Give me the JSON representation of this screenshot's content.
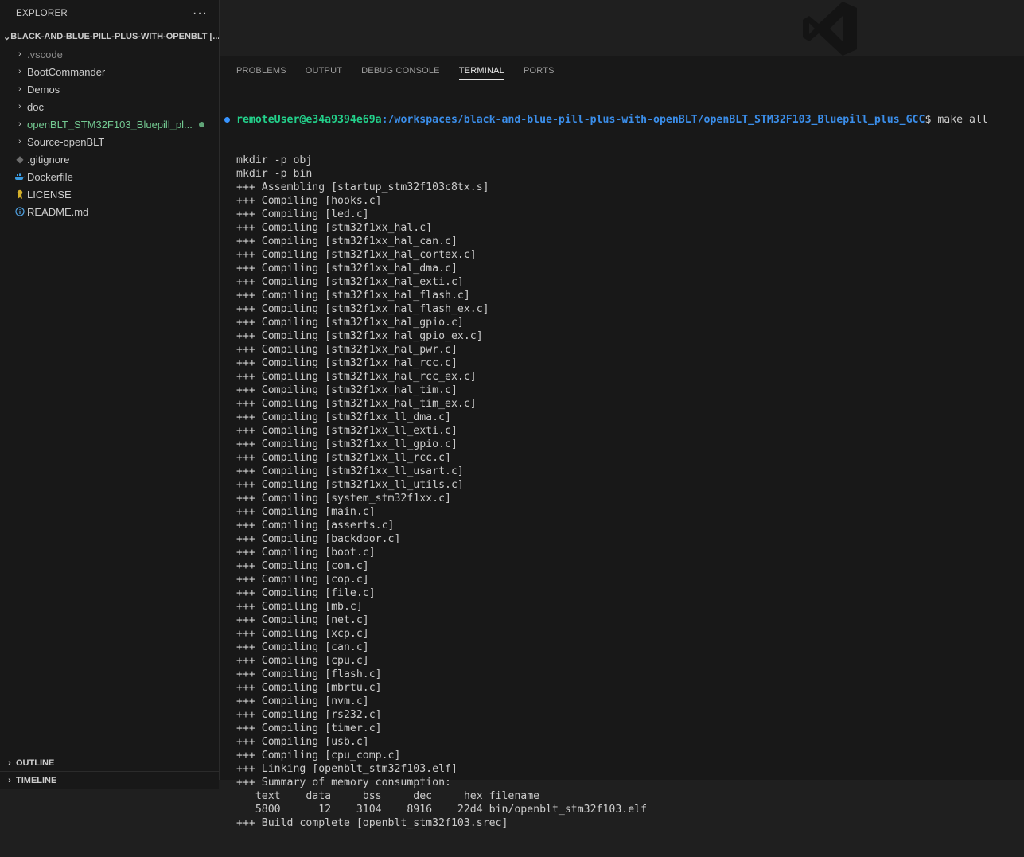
{
  "sidebar": {
    "title": "EXPLORER",
    "more": "···",
    "workspace": "BLACK-AND-BLUE-PILL-PLUS-WITH-OPENBLT [...",
    "items": [
      {
        "label": ".vscode",
        "kind": "folder"
      },
      {
        "label": "BootCommander",
        "kind": "folder"
      },
      {
        "label": "Demos",
        "kind": "folder"
      },
      {
        "label": "doc",
        "kind": "folder"
      },
      {
        "label": "openBLT_STM32F103_Bluepill_pl...",
        "kind": "folder"
      },
      {
        "label": "Source-openBLT",
        "kind": "folder"
      },
      {
        "label": ".gitignore",
        "kind": "file"
      },
      {
        "label": "Dockerfile",
        "kind": "file"
      },
      {
        "label": "LICENSE",
        "kind": "file"
      },
      {
        "label": "README.md",
        "kind": "file"
      }
    ],
    "outline": "OUTLINE",
    "timeline": "TIMELINE"
  },
  "panel": {
    "tabs": [
      "PROBLEMS",
      "OUTPUT",
      "DEBUG CONSOLE",
      "TERMINAL",
      "PORTS"
    ],
    "active_tab": "TERMINAL"
  },
  "terminal": {
    "prompt_user": "remoteUser@e34a9394e69a",
    "prompt_path": ":/workspaces/black-and-blue-pill-plus-with-openBLT/openBLT_STM32F103_Bluepill_plus_GCC",
    "prompt_cmd": "$ make all",
    "lines": [
      "mkdir -p obj",
      "mkdir -p bin",
      "+++ Assembling [startup_stm32f103c8tx.s]",
      "+++ Compiling [hooks.c]",
      "+++ Compiling [led.c]",
      "+++ Compiling [stm32f1xx_hal.c]",
      "+++ Compiling [stm32f1xx_hal_can.c]",
      "+++ Compiling [stm32f1xx_hal_cortex.c]",
      "+++ Compiling [stm32f1xx_hal_dma.c]",
      "+++ Compiling [stm32f1xx_hal_exti.c]",
      "+++ Compiling [stm32f1xx_hal_flash.c]",
      "+++ Compiling [stm32f1xx_hal_flash_ex.c]",
      "+++ Compiling [stm32f1xx_hal_gpio.c]",
      "+++ Compiling [stm32f1xx_hal_gpio_ex.c]",
      "+++ Compiling [stm32f1xx_hal_pwr.c]",
      "+++ Compiling [stm32f1xx_hal_rcc.c]",
      "+++ Compiling [stm32f1xx_hal_rcc_ex.c]",
      "+++ Compiling [stm32f1xx_hal_tim.c]",
      "+++ Compiling [stm32f1xx_hal_tim_ex.c]",
      "+++ Compiling [stm32f1xx_ll_dma.c]",
      "+++ Compiling [stm32f1xx_ll_exti.c]",
      "+++ Compiling [stm32f1xx_ll_gpio.c]",
      "+++ Compiling [stm32f1xx_ll_rcc.c]",
      "+++ Compiling [stm32f1xx_ll_usart.c]",
      "+++ Compiling [stm32f1xx_ll_utils.c]",
      "+++ Compiling [system_stm32f1xx.c]",
      "+++ Compiling [main.c]",
      "+++ Compiling [asserts.c]",
      "+++ Compiling [backdoor.c]",
      "+++ Compiling [boot.c]",
      "+++ Compiling [com.c]",
      "+++ Compiling [cop.c]",
      "+++ Compiling [file.c]",
      "+++ Compiling [mb.c]",
      "+++ Compiling [net.c]",
      "+++ Compiling [xcp.c]",
      "+++ Compiling [can.c]",
      "+++ Compiling [cpu.c]",
      "+++ Compiling [flash.c]",
      "+++ Compiling [mbrtu.c]",
      "+++ Compiling [nvm.c]",
      "+++ Compiling [rs232.c]",
      "+++ Compiling [timer.c]",
      "+++ Compiling [usb.c]",
      "+++ Compiling [cpu_comp.c]",
      "+++ Linking [openblt_stm32f103.elf]",
      "+++ Summary of memory consumption:",
      "   text    data     bss     dec     hex filename",
      "   5800      12    3104    8916    22d4 bin/openblt_stm32f103.elf",
      "+++ Build complete [openblt_stm32f103.srec]"
    ]
  }
}
